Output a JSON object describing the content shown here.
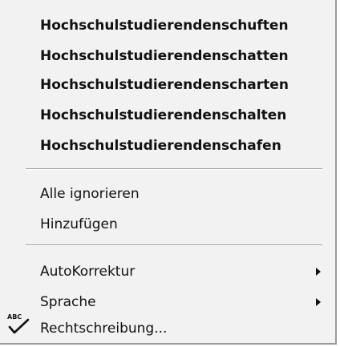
{
  "menu": {
    "suggestions": [
      "Hochschulstudierendenschuften",
      "Hochschulstudierendenschatten",
      "Hochschulstudierendenscharten",
      "Hochschulstudierendenschalten",
      "Hochschulstudierendenschafen"
    ],
    "ignore_all": "Alle ignorieren",
    "add": "Hinzufügen",
    "autocorrect": "AutoKorrektur",
    "language": "Sprache",
    "spelling": "Rechtschreibung...",
    "spelling_icon_label": "ABC",
    "spelling_icon": "spellcheck-icon",
    "submenu_icon": "submenu-arrow-icon"
  }
}
